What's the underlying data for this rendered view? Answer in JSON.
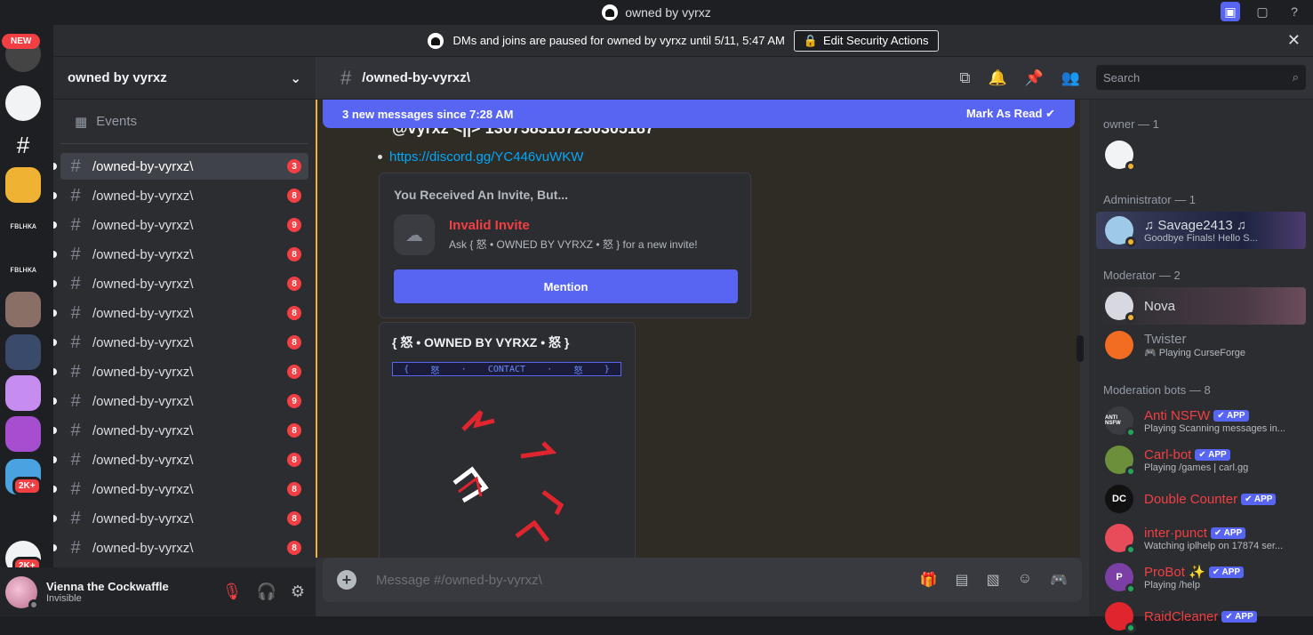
{
  "window": {
    "title": "owned by vyrxz"
  },
  "banner": {
    "text": "DMs and joins are paused for owned by vyrxz until 5/11, 5:47 AM",
    "button": "Edit Security Actions"
  },
  "guilds": {
    "new_badge": "NEW",
    "items": [
      {
        "label": "",
        "color": "#444"
      },
      {
        "label": "",
        "color": "#f2f3f5"
      },
      {
        "label": "#",
        "color": "#1e1f22"
      },
      {
        "label": "",
        "color": "#f0b232"
      },
      {
        "label": "ꜰʙʟʜᴋᴀ",
        "color": "#1e1f22"
      },
      {
        "label": "ꜰʙʟʜᴋᴀ",
        "color": "#1e1f22"
      },
      {
        "label": "",
        "color": "#8a6f66"
      },
      {
        "label": "",
        "color": "#3a4a6b"
      },
      {
        "label": "",
        "color": "#c68cf0"
      },
      {
        "label": "",
        "color": "#a64dd0"
      },
      {
        "label": "",
        "color": "#4aa3e0"
      },
      {
        "label": "",
        "color": "#1e1f22"
      },
      {
        "label": "",
        "color": "#f2f3f5"
      }
    ],
    "badges": [
      "2K+",
      "2K+"
    ]
  },
  "sidebar": {
    "server_name": "owned by vyrxz",
    "events_label": "Events",
    "channels": [
      {
        "name": "/owned-by-vyrxz\\",
        "mentions": "3",
        "selected": true
      },
      {
        "name": "/owned-by-vyrxz\\",
        "mentions": "8"
      },
      {
        "name": "/owned-by-vyrxz\\",
        "mentions": "9"
      },
      {
        "name": "/owned-by-vyrxz\\",
        "mentions": "8"
      },
      {
        "name": "/owned-by-vyrxz\\",
        "mentions": "8"
      },
      {
        "name": "/owned-by-vyrxz\\",
        "mentions": "8"
      },
      {
        "name": "/owned-by-vyrxz\\",
        "mentions": "8"
      },
      {
        "name": "/owned-by-vyrxz\\",
        "mentions": "8"
      },
      {
        "name": "/owned-by-vyrxz\\",
        "mentions": "9"
      },
      {
        "name": "/owned-by-vyrxz\\",
        "mentions": "8"
      },
      {
        "name": "/owned-by-vyrxz\\",
        "mentions": "8"
      },
      {
        "name": "/owned-by-vyrxz\\",
        "mentions": "8"
      },
      {
        "name": "/owned-by-vyrxz\\",
        "mentions": "8"
      },
      {
        "name": "/owned-by-vyrxz\\",
        "mentions": "8"
      }
    ]
  },
  "user": {
    "name": "Vienna the Cockwaffle",
    "status": "Invisible"
  },
  "chat": {
    "channel_name": "/owned-by-vyrxz\\",
    "search_placeholder": "Search",
    "new_messages": "3 new messages since 7:28 AM",
    "mark_read": "Mark As Read",
    "message_header": "@vyrxz <||> 1367583187250305187",
    "link": "https://discord.gg/YC446vuWKW",
    "invite": {
      "title": "You Received An Invite, But...",
      "status": "Invalid Invite",
      "sub": "Ask { 怒 • OWNED BY VYRXZ • 怒 } for a new invite!",
      "button": "Mention"
    },
    "embed": {
      "title": "{ 怒 • OWNED BY VYRXZ • 怒 }",
      "contact": [
        "{",
        "怒",
        "·",
        "CONTACT",
        "·",
        "怒",
        "}"
      ]
    },
    "composer_placeholder": "Message #/owned-by-vyrxz\\"
  },
  "members": {
    "groups": [
      {
        "title": "owner — 1",
        "members": [
          {
            "name": "",
            "activity": "",
            "color": "#f2f3f5",
            "status": "#f0b232"
          }
        ]
      },
      {
        "title": "Administrator — 1",
        "members": [
          {
            "name": "♫ Savage2413 ♫",
            "activity": "Goodbye Finals! Hello S...",
            "color": "#9fc9e8",
            "status": "#f0b232",
            "style": "banner"
          }
        ]
      },
      {
        "title": "Moderator — 2",
        "members": [
          {
            "name": "Nova",
            "activity": "",
            "color": "#d8d8e0",
            "status": "#f0b232",
            "style": "nova"
          },
          {
            "name": "Twister",
            "activity": "🎮 Playing CurseForge",
            "color": "#f26c22",
            "status": "",
            "grey": true
          }
        ]
      },
      {
        "title": "Moderation bots — 8",
        "members": [
          {
            "name": "Anti NSFW",
            "activity": "Playing Scanning messages in...",
            "color": "#3a3c42",
            "status": "#23a55a",
            "app": "APP",
            "red": true,
            "initials": "ANTI NSFW"
          },
          {
            "name": "Carl-bot",
            "activity": "Playing /games | carl.gg",
            "color": "#6b8f3a",
            "status": "#23a55a",
            "app": "APP",
            "red": true
          },
          {
            "name": "Double Counter",
            "activity": "",
            "color": "#111",
            "status": "",
            "app": "APP",
            "red": true,
            "initials": "DC"
          },
          {
            "name": "inter·punct",
            "activity": "Watching iplhelp on 17874 ser...",
            "color": "#e84c5a",
            "status": "#23a55a",
            "app": "APP",
            "red": true
          },
          {
            "name": "ProBot ✨",
            "activity": "Playing /help",
            "color": "#7b3fa6",
            "status": "#23a55a",
            "app": "APP",
            "red": true,
            "initials": "P"
          },
          {
            "name": "RaidCleaner",
            "activity": "",
            "color": "#e0252f",
            "status": "#23a55a",
            "app": "APP",
            "red": true
          }
        ]
      }
    ]
  },
  "icons": {
    "threads": "threads-icon",
    "bell": "bell-icon",
    "pin": "pin-icon",
    "members": "members-icon",
    "gift": "gift-icon",
    "gif": "gif-icon",
    "sticker": "sticker-icon",
    "emoji": "emoji-icon",
    "apps": "apps-icon"
  }
}
